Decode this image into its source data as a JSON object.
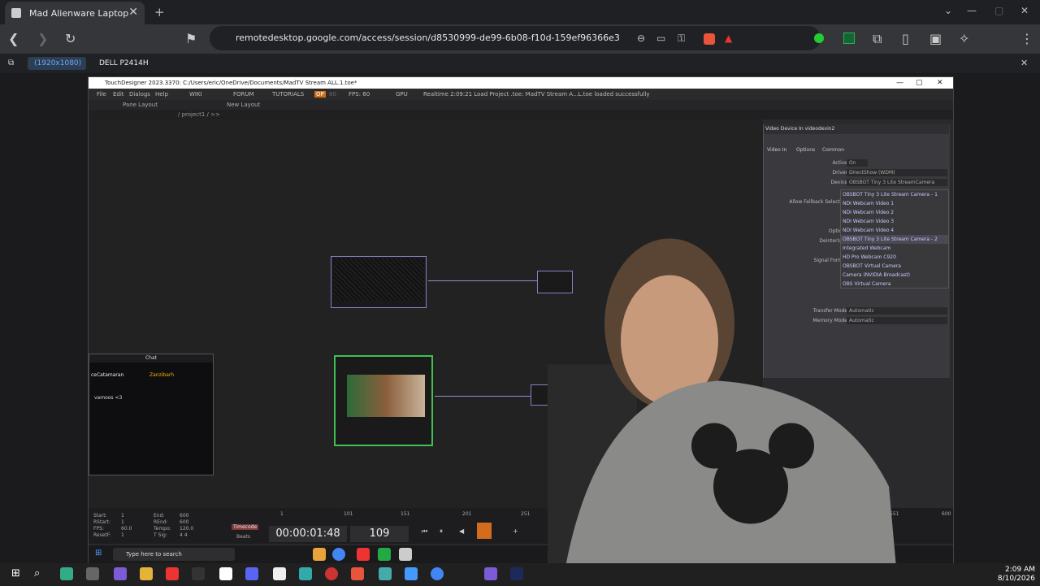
{
  "browser": {
    "tab_title": "Mad Alienware Laptop",
    "url": "remotedesktop.google.com/access/session/d8530999-de99-6b08-f10d-159ef96366e3",
    "display_resolution": "(1920x1080)",
    "display_name": "DELL P2414H"
  },
  "touchdesigner": {
    "title": "TouchDesigner 2023.3370: C:/Users/eric/OneDrive/Documents/MadTV Stream ALL.1.toe*",
    "menu": [
      "File",
      "Edit",
      "Dialogs",
      "Help",
      "WIKI",
      "FORUM",
      "TUTORIALS",
      "OP",
      "60",
      "FPS: 60",
      "GPU"
    ],
    "status_msg": "Realtime  2:09:21 Load Project .toe: MadTV Stream A...L.toe loaded successfully",
    "pane_layout": "Pane Layout",
    "new_layout": "New Layout",
    "path": "/ project1 / >>",
    "panel": {
      "title": "Video Device In  videodevin2",
      "tabs": [
        "Video In",
        "Options",
        "Common"
      ],
      "active_label": "Active",
      "active_value": "On",
      "driver_label": "Driver",
      "driver_value": "DirectShow (WDM)",
      "device_label": "Device",
      "device_value": "OBSBOT Tiny 3 Lite StreamCamera",
      "fallback_label": "Allow Fallback Selection",
      "options_label": "Options",
      "deinterlace_label": "Deinterlace",
      "signal_label": "Signal Format",
      "transfer_label": "Transfer Mode",
      "transfer_value": "Automatic",
      "memory_label": "Memory Mode",
      "memory_value": "Automatic",
      "device_options": [
        "OBSBOT Tiny 3 Lite Stream Camera - 1",
        "NDI Webcam Video 1",
        "NDI Webcam Video 2",
        "NDI Webcam Video 3",
        "NDI Webcam Video 4",
        "OBSBOT Tiny 3 Lite Stream Camera - 2",
        "Integrated Webcam",
        "HD Pro Webcam C920",
        "OBSBOT Virtual Camera",
        "Camera (NVIDIA Broadcast)",
        "OBS Virtual Camera"
      ]
    },
    "chat": {
      "header": "Chat",
      "user1": "ceCatamaran",
      "user2": "Zanzibarh",
      "msg": "vamoos <3"
    },
    "timeline": {
      "start": "Start:",
      "start_v": "1",
      "rstart": "RStart:",
      "rstart_v": "1",
      "fps": "FPS:",
      "fps_v": "60.0",
      "resetf": "ResetF:",
      "resetf_v": "1",
      "end": "End:",
      "end_v": "600",
      "rend": "REnd:",
      "rend_v": "600",
      "tempo": "Tempo:",
      "tempo_v": "120.0",
      "tsig": "T Sig:",
      "tsig_v": "4   4",
      "timecode_label": "Timecode",
      "beats_label": "Beats",
      "timecode": "00:00:01:48",
      "frame": "109",
      "ticks": [
        "1",
        "101",
        "151",
        "201",
        "251",
        "551",
        "600"
      ]
    },
    "taskbar_search": "Type here to search"
  },
  "clock": {
    "time": "2:09 AM",
    "date": "8/10/2026"
  }
}
